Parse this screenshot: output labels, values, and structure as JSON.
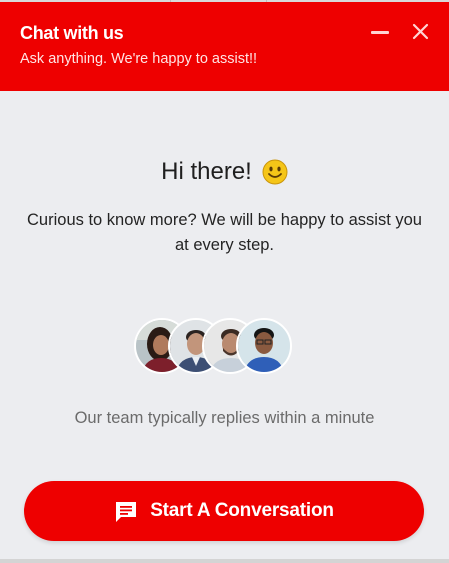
{
  "header": {
    "title": "Chat with us",
    "subtitle": "Ask anything. We're happy to assist!!",
    "minimize_icon": "minimize-icon",
    "close_icon": "close-icon"
  },
  "main": {
    "greeting": "Hi there!",
    "greeting_emoji_icon": "smiley-emoji-icon",
    "intro": "Curious to know more? We will be happy to assist you at every step.",
    "team_avatars": [
      "agent-avatar-1",
      "agent-avatar-2",
      "agent-avatar-3",
      "agent-avatar-4"
    ],
    "reply_note": "Our team typically replies within a minute"
  },
  "cta": {
    "label": "Start A Conversation",
    "icon": "chat-message-icon"
  },
  "colors": {
    "brand_red": "#ee0000",
    "panel_background": "#ecedf0",
    "emoji_yellow": "#f5c518"
  }
}
